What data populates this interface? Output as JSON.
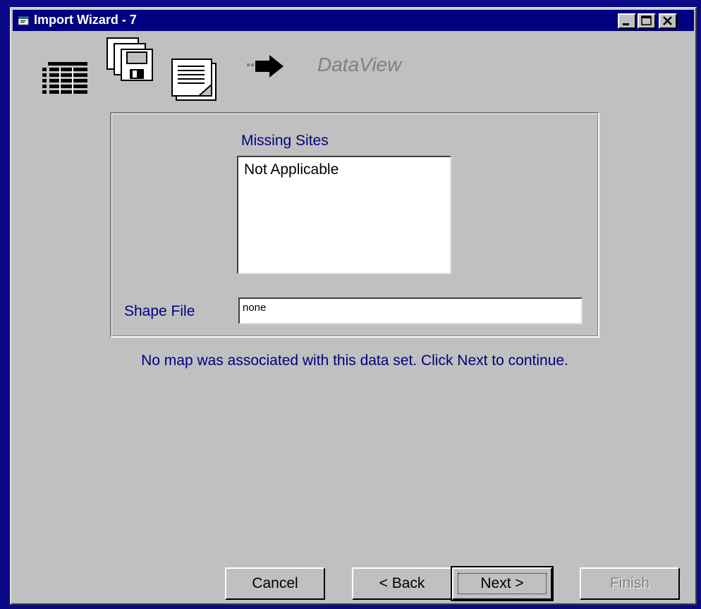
{
  "window": {
    "title": "Import Wizard - 7",
    "controls": [
      "minimize-icon",
      "maximize-icon",
      "close-icon"
    ]
  },
  "header": {
    "icons": [
      "table-icon",
      "floppy-disks-icon",
      "document-icon",
      "arrow-right-icon"
    ],
    "product_name": "DataView"
  },
  "form": {
    "missing_sites_label": "Missing Sites",
    "missing_sites_items": [
      "Not Applicable"
    ],
    "shape_file_label": "Shape File",
    "shape_file_value": "none"
  },
  "message": "No map was associated with this data set. Click Next to continue.",
  "buttons": {
    "cancel": "Cancel",
    "back": "< Back",
    "next": "Next >",
    "finish": "Finish"
  },
  "colors": {
    "desktop": "#0a0a86",
    "titlebar": "#000080",
    "window_face": "#c0c0c0",
    "label_text": "#000080"
  }
}
